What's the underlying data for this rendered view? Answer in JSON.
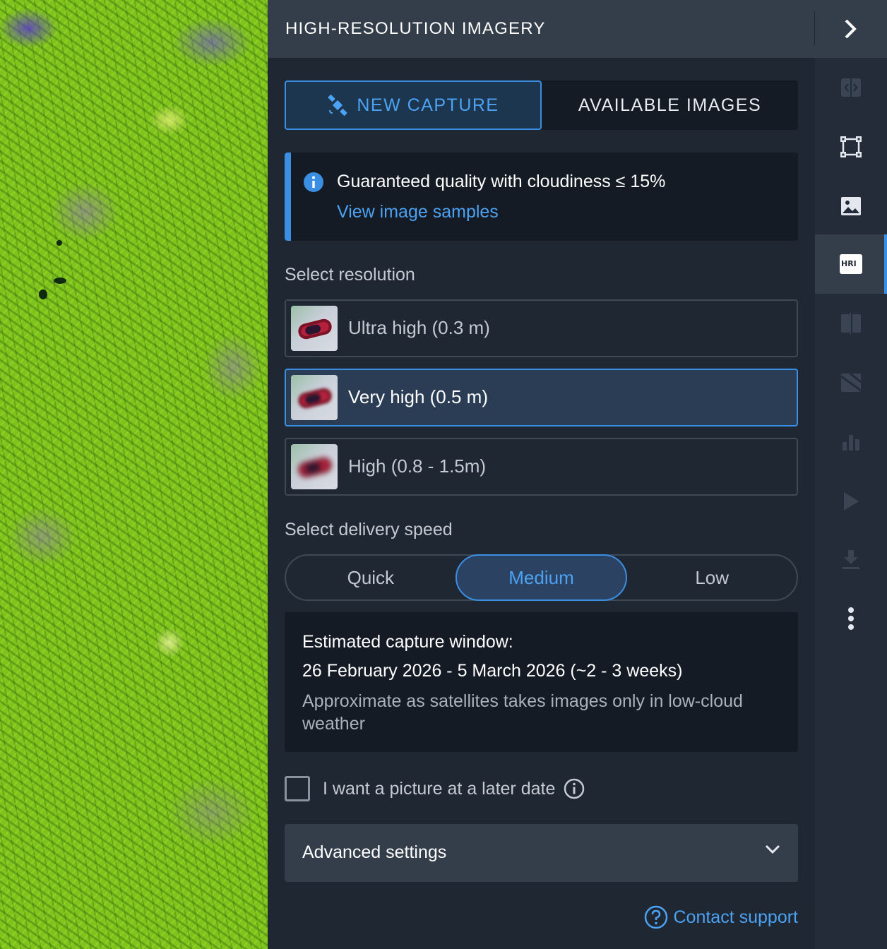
{
  "header": {
    "title": "HIGH-RESOLUTION IMAGERY"
  },
  "tabs": {
    "new_capture": "NEW CAPTURE",
    "available_images": "AVAILABLE IMAGES"
  },
  "info": {
    "text": "Guaranteed quality with cloudiness ≤ 15%",
    "link": "View image samples"
  },
  "resolution": {
    "label": "Select resolution",
    "options": [
      {
        "label": "Ultra high (0.3 m)"
      },
      {
        "label": "Very high (0.5 m)"
      },
      {
        "label": "High (0.8 - 1.5m)"
      }
    ],
    "selected": "Very high (0.5 m)"
  },
  "delivery": {
    "label": "Select delivery speed",
    "options": [
      "Quick",
      "Medium",
      "Low"
    ],
    "selected": "Medium"
  },
  "estimate": {
    "title": "Estimated capture window:",
    "dates": "26 February 2026 - 5 March 2026 (~2 - 3 weeks)",
    "note": "Approximate as satellites takes images only in low-cloud weather"
  },
  "later_date": {
    "label": "I want a picture at a later date",
    "checked": false
  },
  "advanced": {
    "label": "Advanced settings"
  },
  "support": {
    "label": "Contact support"
  },
  "rail": {
    "items": [
      "compare-icon",
      "aoi-icon",
      "image-icon",
      "hri-icon",
      "split-icon",
      "zoning-icon",
      "analytics-icon",
      "timelapse-icon",
      "download-icon",
      "more-icon"
    ],
    "active": "hri-icon",
    "hri_badge": "HRI"
  },
  "colors": {
    "accent": "#3b8fe3",
    "panel": "#1f2733",
    "header": "#343e4a"
  }
}
